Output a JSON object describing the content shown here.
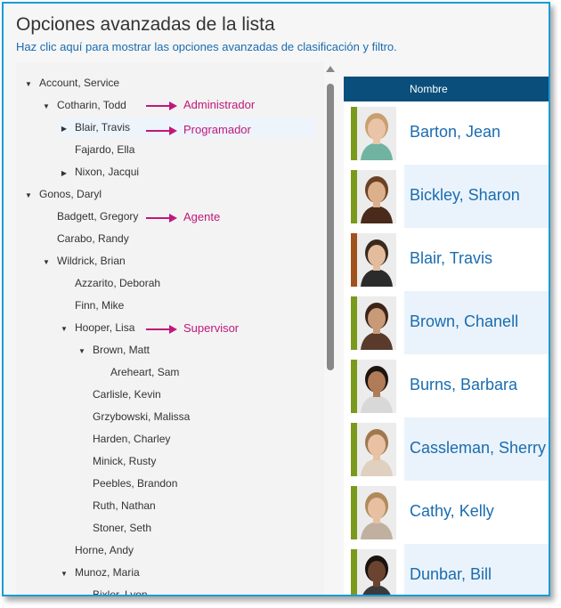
{
  "header": {
    "title": "Opciones avanzadas de la lista",
    "subtitle": "Haz clic aquí para mostrar las opciones avanzadas de clasificación y filtro."
  },
  "tree": [
    {
      "label": "Account, Service",
      "toggle": "expanded"
    },
    {
      "label": "Cotharin, Todd",
      "toggle": "expanded"
    },
    {
      "label": "Blair, Travis",
      "toggle": "collapsed"
    },
    {
      "label": "Fajardo, Ella",
      "toggle": "none"
    },
    {
      "label": "Nixon, Jacqui",
      "toggle": "collapsed"
    },
    {
      "label": "Gonos, Daryl",
      "toggle": "expanded"
    },
    {
      "label": "Badgett, Gregory",
      "toggle": "none"
    },
    {
      "label": "Carabo, Randy",
      "toggle": "none"
    },
    {
      "label": "Wildrick, Brian",
      "toggle": "expanded"
    },
    {
      "label": "Azzarito, Deborah",
      "toggle": "none"
    },
    {
      "label": "Finn, Mike",
      "toggle": "none"
    },
    {
      "label": "Hooper, Lisa",
      "toggle": "expanded"
    },
    {
      "label": "Brown, Matt",
      "toggle": "expanded"
    },
    {
      "label": "Areheart, Sam",
      "toggle": "none"
    },
    {
      "label": "Carlisle, Kevin",
      "toggle": "none"
    },
    {
      "label": "Grzybowski, Malissa",
      "toggle": "none"
    },
    {
      "label": "Harden, Charley",
      "toggle": "none"
    },
    {
      "label": "Minick, Rusty",
      "toggle": "none"
    },
    {
      "label": "Peebles, Brandon",
      "toggle": "none"
    },
    {
      "label": "Ruth, Nathan",
      "toggle": "none"
    },
    {
      "label": "Stoner, Seth",
      "toggle": "none"
    },
    {
      "label": "Horne, Andy",
      "toggle": "none"
    },
    {
      "label": "Munoz, Maria",
      "toggle": "expanded"
    },
    {
      "label": "Bixler, Lyon",
      "toggle": "none"
    }
  ],
  "annotations": [
    {
      "label": "Administrador"
    },
    {
      "label": "Programador"
    },
    {
      "label": "Agente"
    },
    {
      "label": "Supervisor"
    }
  ],
  "grid": {
    "column_header": "Nombre",
    "rows": [
      {
        "name": "Barton, Jean",
        "status_color": "#7a9a1c",
        "skin": "#e9c4a6",
        "hair": "#c8a070",
        "shirt": "#6fb3a0"
      },
      {
        "name": "Bickley, Sharon",
        "status_color": "#7a9a1c",
        "skin": "#dcb08a",
        "hair": "#6b4226",
        "shirt": "#4a2a1a"
      },
      {
        "name": "Blair, Travis",
        "status_color": "#a0521c",
        "skin": "#e2bc9c",
        "hair": "#3a2a1e",
        "shirt": "#2b2b2b"
      },
      {
        "name": "Brown, Chanell",
        "status_color": "#7a9a1c",
        "skin": "#c99a78",
        "hair": "#3d2418",
        "shirt": "#5a3a2a"
      },
      {
        "name": "Burns, Barbara",
        "status_color": "#7a9a1c",
        "skin": "#b07c58",
        "hair": "#1e1410",
        "shirt": "#d8d8d8"
      },
      {
        "name": "Cassleman, Sherry",
        "status_color": "#7a9a1c",
        "skin": "#e8c2a2",
        "hair": "#a07850",
        "shirt": "#e0d0c0"
      },
      {
        "name": "Cathy, Kelly",
        "status_color": "#7a9a1c",
        "skin": "#e6c0a0",
        "hair": "#b08a5a",
        "shirt": "#c0b0a0"
      },
      {
        "name": "Dunbar, Bill",
        "status_color": "#7a9a1c",
        "skin": "#6a4430",
        "hair": "#1a120e",
        "shirt": "#3a3a3a"
      }
    ]
  },
  "colors": {
    "accent": "#1a9bd7",
    "header_bg": "#0a4f7c",
    "callout": "#c0187a",
    "link": "#1a6cb0"
  }
}
